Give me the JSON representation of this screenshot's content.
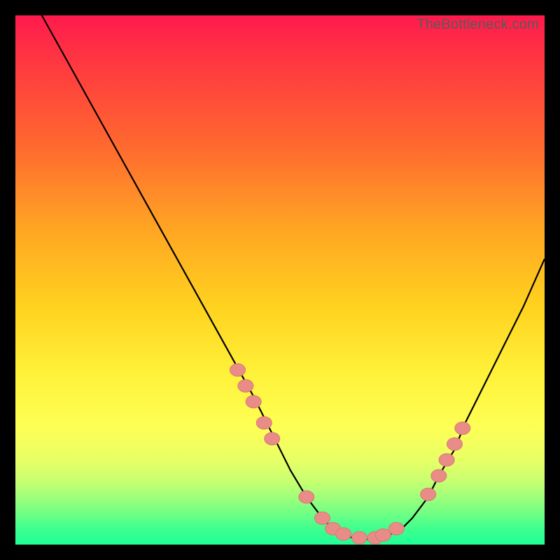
{
  "watermark": "TheBottleneck.com",
  "colors": {
    "background": "#000000",
    "curve": "#000000",
    "marker_fill": "#e98b86",
    "marker_stroke": "#d97a74"
  },
  "chart_data": {
    "type": "line",
    "title": "",
    "xlabel": "",
    "ylabel": "",
    "xlim": [
      0,
      100
    ],
    "ylim": [
      0,
      100
    ],
    "grid": false,
    "legend": false,
    "series": [
      {
        "name": "curve",
        "x": [
          5,
          10,
          15,
          20,
          25,
          30,
          35,
          40,
          45,
          50,
          52,
          55,
          58,
          60,
          63,
          65,
          68,
          70,
          73,
          75,
          78,
          80,
          83,
          85,
          88,
          92,
          96,
          100
        ],
        "y": [
          100,
          91,
          82,
          73,
          64,
          55,
          46,
          37,
          28,
          18,
          14,
          9,
          5,
          3,
          1.5,
          1,
          1,
          1.5,
          3,
          5,
          9,
          13,
          18,
          23,
          29,
          37,
          45,
          54
        ]
      }
    ],
    "markers": [
      {
        "x": 42.0,
        "y": 33.0
      },
      {
        "x": 43.5,
        "y": 30.0
      },
      {
        "x": 45.0,
        "y": 27.0
      },
      {
        "x": 47.0,
        "y": 23.0
      },
      {
        "x": 48.5,
        "y": 20.0
      },
      {
        "x": 55.0,
        "y": 9.0
      },
      {
        "x": 58.0,
        "y": 5.0
      },
      {
        "x": 60.0,
        "y": 3.0
      },
      {
        "x": 62.0,
        "y": 2.0
      },
      {
        "x": 65.0,
        "y": 1.3
      },
      {
        "x": 68.0,
        "y": 1.3
      },
      {
        "x": 69.5,
        "y": 1.8
      },
      {
        "x": 72.0,
        "y": 3.0
      },
      {
        "x": 78.0,
        "y": 9.5
      },
      {
        "x": 80.0,
        "y": 13.0
      },
      {
        "x": 81.5,
        "y": 16.0
      },
      {
        "x": 83.0,
        "y": 19.0
      },
      {
        "x": 84.5,
        "y": 22.0
      }
    ]
  }
}
